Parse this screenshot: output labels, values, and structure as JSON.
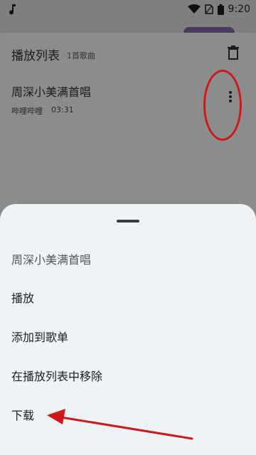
{
  "status_bar": {
    "time": "9:20",
    "icons": [
      "music-note-icon",
      "wifi-icon",
      "sim-icon",
      "battery-icon"
    ]
  },
  "playlist": {
    "title": "播放列表",
    "count": "1首歌曲",
    "songs": [
      {
        "title": "周深小美满首唱",
        "artist": "哔哩哔哩",
        "duration": "03:31"
      }
    ]
  },
  "sheet": {
    "items": [
      {
        "label": "周深小美满首唱"
      },
      {
        "label": "播放"
      },
      {
        "label": "添加到歌单"
      },
      {
        "label": "在播放列表中移除"
      },
      {
        "label": "下载"
      }
    ]
  },
  "annotation_color": "#d01818"
}
